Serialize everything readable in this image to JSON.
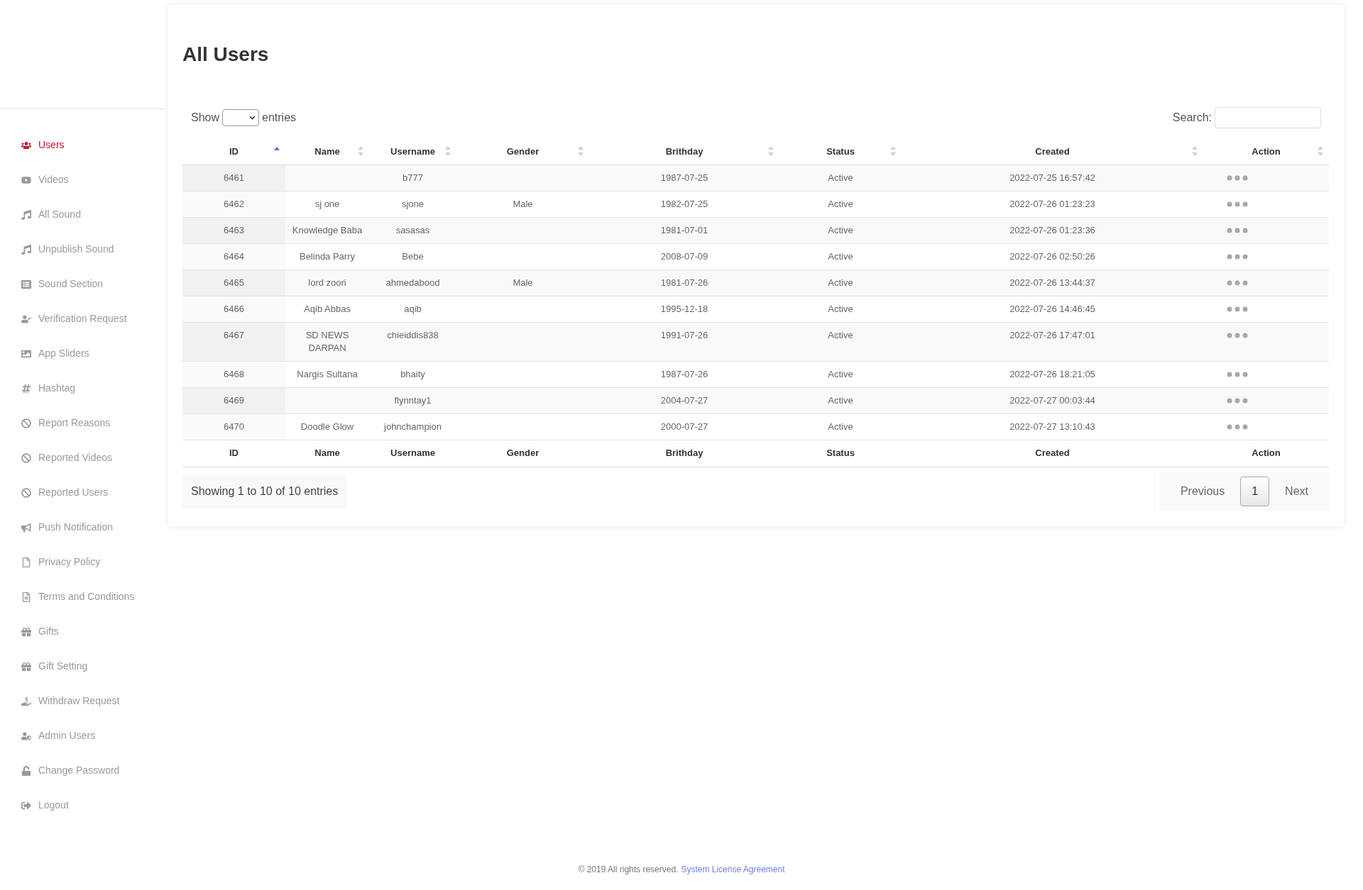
{
  "sidebar": {
    "items": [
      {
        "label": "Users",
        "selected": true
      },
      {
        "label": "Videos",
        "selected": false
      },
      {
        "label": "All Sound",
        "selected": false
      },
      {
        "label": "Unpublish Sound",
        "selected": false
      },
      {
        "label": "Sound Section",
        "selected": false
      },
      {
        "label": "Verification Request",
        "selected": false
      },
      {
        "label": "App Sliders",
        "selected": false
      },
      {
        "label": "Hashtag",
        "selected": false
      },
      {
        "label": "Report Reasons",
        "selected": false
      },
      {
        "label": "Reported Videos",
        "selected": false
      },
      {
        "label": "Reported Users",
        "selected": false
      },
      {
        "label": "Push Notification",
        "selected": false
      },
      {
        "label": "Privacy Policy",
        "selected": false
      },
      {
        "label": "Terms and Conditions",
        "selected": false
      },
      {
        "label": "Gifts",
        "selected": false
      },
      {
        "label": "Gift Setting",
        "selected": false
      },
      {
        "label": "Withdraw Request",
        "selected": false
      },
      {
        "label": "Admin Users",
        "selected": false
      },
      {
        "label": "Change Password",
        "selected": false
      },
      {
        "label": "Logout",
        "selected": false
      }
    ]
  },
  "page_title": "All Users",
  "length_control": {
    "before": "Show",
    "after": "entries"
  },
  "search": {
    "label": "Search:"
  },
  "table": {
    "columns": [
      {
        "label": "ID",
        "sorted": true
      },
      {
        "label": "Name",
        "sorted": false
      },
      {
        "label": "Username",
        "sorted": false
      },
      {
        "label": "Gender",
        "sorted": false
      },
      {
        "label": "Brithday",
        "sorted": false
      },
      {
        "label": "Status",
        "sorted": false
      },
      {
        "label": "Created",
        "sorted": false
      },
      {
        "label": "Action",
        "sorted": false
      }
    ],
    "rows": [
      {
        "id": "6461",
        "name": "",
        "username": "b777",
        "gender": "",
        "birthday": "1987-07-25",
        "status": "Active",
        "created": "2022-07-25 16:57:42"
      },
      {
        "id": "6462",
        "name": "sj one",
        "username": "sjone",
        "gender": "Male",
        "birthday": "1982-07-25",
        "status": "Active",
        "created": "2022-07-26 01:23:23"
      },
      {
        "id": "6463",
        "name": "Knowledge Baba",
        "username": "sasasas",
        "gender": "",
        "birthday": "1981-07-01",
        "status": "Active",
        "created": "2022-07-26 01:23:36"
      },
      {
        "id": "6464",
        "name": "Belinda Parry",
        "username": "Bebe",
        "gender": "",
        "birthday": "2008-07-09",
        "status": "Active",
        "created": "2022-07-26 02:50:26"
      },
      {
        "id": "6465",
        "name": "lord zoori",
        "username": "ahmedabood",
        "gender": "Male",
        "birthday": "1981-07-26",
        "status": "Active",
        "created": "2022-07-26 13:44:37"
      },
      {
        "id": "6466",
        "name": "Aqib Abbas",
        "username": "aqib",
        "gender": "",
        "birthday": "1995-12-18",
        "status": "Active",
        "created": "2022-07-26 14:46:45"
      },
      {
        "id": "6467",
        "name": "SD NEWS DARPAN",
        "username": "chieiddis838",
        "gender": "",
        "birthday": "1991-07-26",
        "status": "Active",
        "created": "2022-07-26 17:47:01"
      },
      {
        "id": "6468",
        "name": "Nargis Sultana",
        "username": "bhaity",
        "gender": "",
        "birthday": "1987-07-26",
        "status": "Active",
        "created": "2022-07-26 18:21:05"
      },
      {
        "id": "6469",
        "name": "",
        "username": "flynntay1",
        "gender": "",
        "birthday": "2004-07-27",
        "status": "Active",
        "created": "2022-07-27 00:03:44"
      },
      {
        "id": "6470",
        "name": "Doodle Glow",
        "username": "johnchampion",
        "gender": "",
        "birthday": "2000-07-27",
        "status": "Active",
        "created": "2022-07-27 13:10:43"
      }
    ],
    "footer_columns": [
      "ID",
      "Name",
      "Username",
      "Gender",
      "Brithday",
      "Status",
      "Created",
      "Action"
    ]
  },
  "info": "Showing 1 to 10 of 10 entries",
  "pagination": {
    "previous": "Previous",
    "pages": [
      {
        "label": "1",
        "selected": true
      }
    ],
    "next": "Next"
  },
  "footer": {
    "text": "© 2019 All rights reserved.",
    "link": "System License Agreement"
  }
}
